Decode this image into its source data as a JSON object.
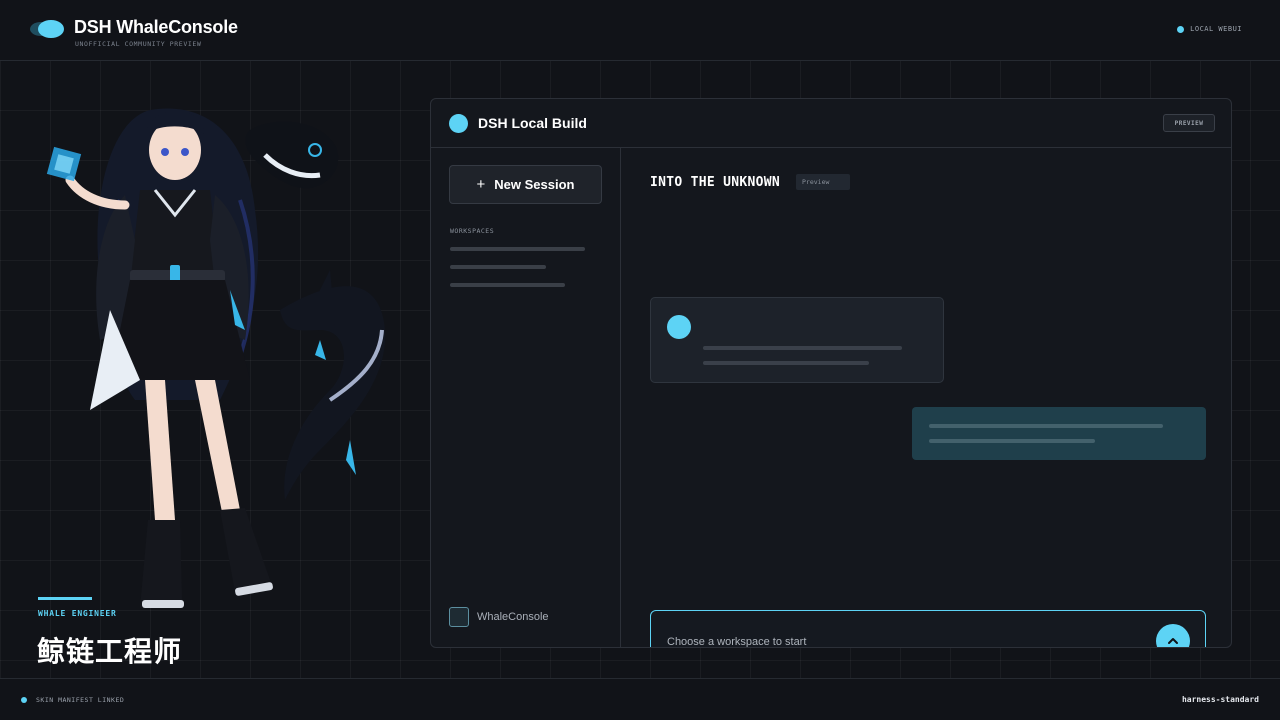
{
  "header": {
    "brand_title": "DSH WhaleConsole",
    "brand_subtitle": "UNOFFICIAL COMMUNITY PREVIEW",
    "status_text": "LOCAL WEBUI"
  },
  "character": {
    "role_label": "WHALE ENGINEER",
    "role_title": "鲸链工程师"
  },
  "window": {
    "title": "DSH Local Build",
    "badge": "PREVIEW",
    "sidebar": {
      "new_session_label": "New Session",
      "workspaces_label": "WORKSPACES",
      "footer_label": "WhaleConsole"
    },
    "chat": {
      "title": "INTO THE UNKNOWN",
      "badge": "Preview",
      "composer_placeholder": "Choose a workspace to start",
      "send_icon": "arrow-up-icon"
    }
  },
  "footer": {
    "left_text": "SKIN MANIFEST LINKED",
    "right_text": "harness-standard"
  },
  "colors": {
    "accent": "#5dd3f5",
    "background": "#111318",
    "panel": "#14171d",
    "user_bubble": "#1f3f4b"
  }
}
